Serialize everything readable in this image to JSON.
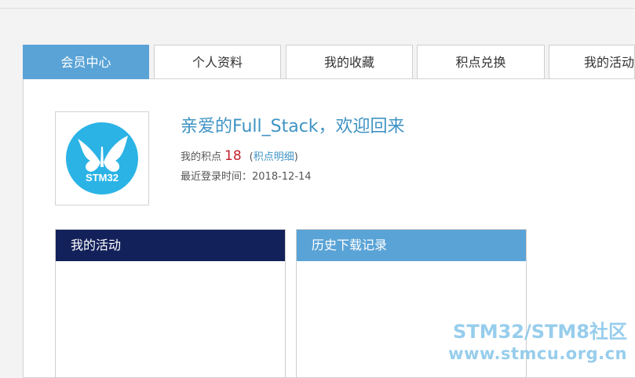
{
  "tabs": [
    {
      "label": "会员中心",
      "active": true
    },
    {
      "label": "个人资料",
      "active": false
    },
    {
      "label": "我的收藏",
      "active": false
    },
    {
      "label": "积点兑换",
      "active": false
    },
    {
      "label": "我的活动",
      "active": false
    }
  ],
  "profile": {
    "avatar_text": "STM32",
    "welcome": "亲爱的Full_Stack，欢迎回来",
    "points_label": "我的积点",
    "points_value": "18",
    "points_link_open": "(",
    "points_link": "积点明细",
    "points_link_close": ")",
    "last_login_label": "最近登录时间：",
    "last_login_value": "2018-12-14"
  },
  "boxes": {
    "activity_title": "我的活动",
    "history_title": "历史下载记录"
  },
  "watermark": {
    "line1": "STM32/STM8社区",
    "line2": "www.stmcu.org.cn"
  },
  "colors": {
    "accent": "#5aa3d6",
    "navy": "#13215a",
    "points": "#c2202c",
    "link": "#3f93c4",
    "logo_circle": "#2bb3e6"
  }
}
